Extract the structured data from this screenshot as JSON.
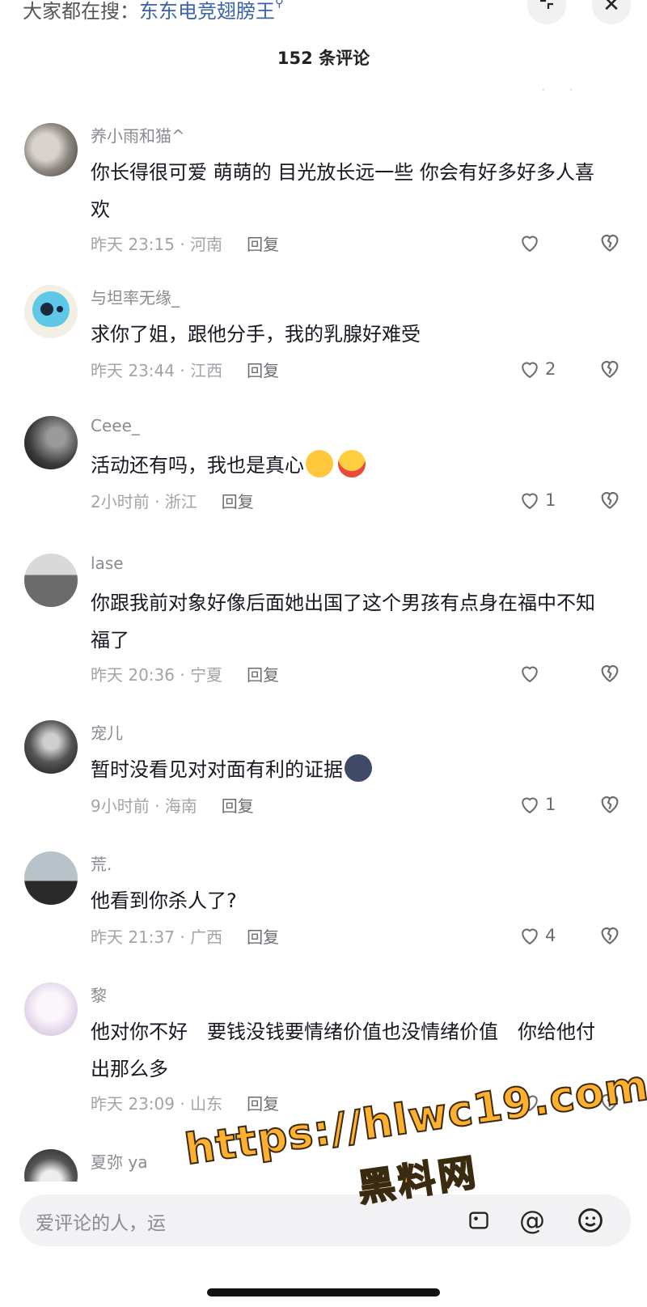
{
  "header": {
    "search_prefix": "大家都在搜：",
    "search_keyword": "东东电竞翅膀王",
    "search_icon": "search-icon",
    "collapse_icon": "collapse-icon",
    "close_icon": "✕",
    "title": "152 条评论"
  },
  "comments": [
    {
      "name": "养小雨和猫^",
      "text": "你长得很可爱 萌萌的 目光放长远一些 你会有好多好多人喜欢",
      "time": "昨天 23:15 · 河南",
      "reply": "回复",
      "likes": ""
    },
    {
      "name": "与坦率无缘_",
      "text": "求你了姐，跟他分手，我的乳腺好难受",
      "time": "昨天 23:44 · 江西",
      "reply": "回复",
      "likes": "2"
    },
    {
      "name": "Ceee_",
      "text": "活动还有吗，我也是真心",
      "time": "2小时前 · 浙江",
      "reply": "回复",
      "likes": "1"
    },
    {
      "name": "lase",
      "text": "你跟我前对象好像后面她出国了这个男孩有点身在福中不知福了",
      "time": "昨天 20:36 · 宁夏",
      "reply": "回复",
      "likes": ""
    },
    {
      "name": "宠儿",
      "text": "暂时没看见对对面有利的证据",
      "time": "9小时前 · 海南",
      "reply": "回复",
      "likes": "1"
    },
    {
      "name": "荒.",
      "text": "他看到你杀人了?",
      "time": "昨天 21:37 · 广西",
      "reply": "回复",
      "likes": "4"
    },
    {
      "name": "黎",
      "text": "他对你不好　要钱没钱要情绪价值也没情绪价值　你给他付出那么多",
      "time": "昨天 23:09 · 山东",
      "reply": "回复",
      "likes": ""
    },
    {
      "name": "夏弥 ya",
      "text": "",
      "time": "",
      "reply": "",
      "likes": ""
    }
  ],
  "input": {
    "placeholder": "爱评论的人，运",
    "at_icon": "@",
    "emoji_icon": "smiley-icon",
    "image_icon": "image-icon"
  },
  "watermark": {
    "url": "https://hlwc19.com",
    "cn": "黑料网"
  },
  "colors": {
    "accent_link": "#3a63a8",
    "watermark": "#ffb02e"
  }
}
